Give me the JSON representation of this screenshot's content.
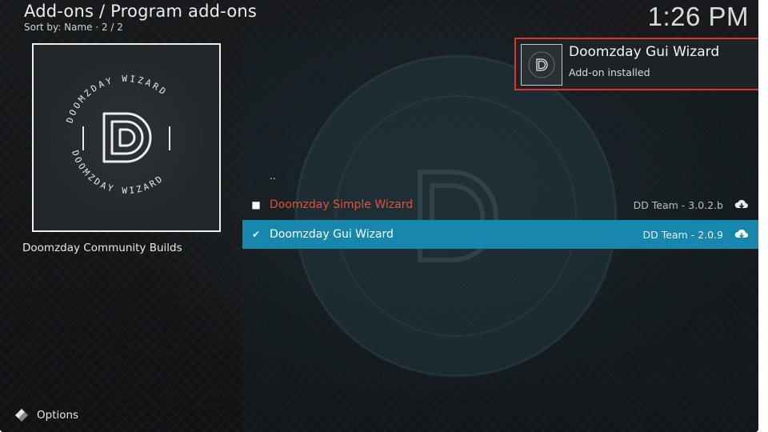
{
  "header": {
    "title": "Add-ons / Program add-ons",
    "sort_info": "Sort by: Name · 2 / 2",
    "clock": "1:26 PM"
  },
  "thumbnail": {
    "logo_text_top": "DOOMZDAY WIZARD",
    "logo_text_bottom": "DOOMZDAY WIZARD",
    "icon": "doomzday-logo"
  },
  "left_label": "Doomzday Community Builds",
  "list": {
    "items": [
      {
        "icon": "",
        "name": "..",
        "meta": ""
      },
      {
        "icon": "square-bullet",
        "name": "Doomzday Simple Wizard",
        "meta": "DD Team - 3.0.2.b",
        "status_icon": "cloud-download-icon",
        "color": "#e0523d"
      },
      {
        "icon": "checkmark",
        "name": "Doomzday Gui Wizard",
        "meta": "DD Team - 2.0.9",
        "status_icon": "cloud-download-icon",
        "selected": true
      }
    ]
  },
  "notification": {
    "title": "Doomzday Gui Wizard",
    "message": "Add-on installed",
    "border_color": "#e0332f"
  },
  "footer": {
    "options_label": "Options"
  },
  "colors": {
    "accent": "#1787ae",
    "red": "#e0523d"
  }
}
